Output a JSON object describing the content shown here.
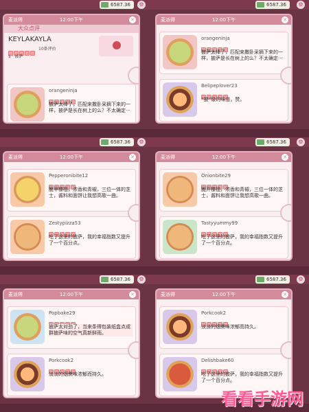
{
  "global": {
    "money": "6587.36",
    "title": "麦派得",
    "time": "12:00下午",
    "section_title": "大众点评"
  },
  "rows": [
    {
      "left": {
        "business": {
          "name": "KEYLAKAYLA",
          "count": "10条评价",
          "price": "$ · 披萨"
        },
        "reviews": [
          {
            "name": "orangeninja",
            "text": "披萨太棒了，匹配来撒卧采摘下来的一样，披萨是长在树上的么？不太确定···",
            "pizza": "veg"
          }
        ]
      },
      "right": {
        "reviews": [
          {
            "name": "orangeninja",
            "text": "披萨太棒了，匹配来撒卧采摘下来的一样，披萨是长在树上的么？不太确定···",
            "pizza": "veg"
          },
          {
            "name": "Belipeplover23",
            "text": "“披”级的味道，赞。",
            "pizza": "choc"
          }
        ]
      }
    },
    {
      "left": {
        "reviews": [
          {
            "name": "Pepperonibite12",
            "text": "脆甲楼棍，浓香和青椒，三位一体的芝士，酱料和面饼让我想高歌一曲。",
            "pizza": "cheese"
          },
          {
            "name": "Zestypizza53",
            "text": "吃了这里的披萨，我的幸福指数又提升了一个百分点。",
            "pizza": "plain"
          }
        ]
      },
      "right": {
        "reviews": [
          {
            "name": "Onionbite29",
            "text": "脆开楼棍，浓香和青椒，三位一体的芝士，酱料和面饼让我想高歌一曲。",
            "pizza": "plain"
          },
          {
            "name": "Tastyyummy99",
            "text": "吃了这里的披萨，我的幸福指数又提升了一个百分点。",
            "pizza": "plain"
          }
        ]
      }
    },
    {
      "left": {
        "reviews": [
          {
            "name": "Popbake29",
            "text": "披萨太对劲了，当来条得包装纸盒点成群披萨味的空气真新鲜雨。",
            "pizza": "veg",
            "highlight": true
          },
          {
            "name": "Porkcook2",
            "text": "淡淡的烟熏味浓郁而持久。",
            "pizza": "choc"
          }
        ]
      },
      "right": {
        "reviews": [
          {
            "name": "Porkcook2",
            "text": "淡淡的烟熏味浓郁而持久。",
            "pizza": "choc"
          },
          {
            "name": "Delishbake60",
            "text": "吃了这里的披萨，我的幸福指数又提升了一个百分点。",
            "pizza": "sauce"
          }
        ]
      }
    }
  ],
  "watermark": "看看手游网"
}
